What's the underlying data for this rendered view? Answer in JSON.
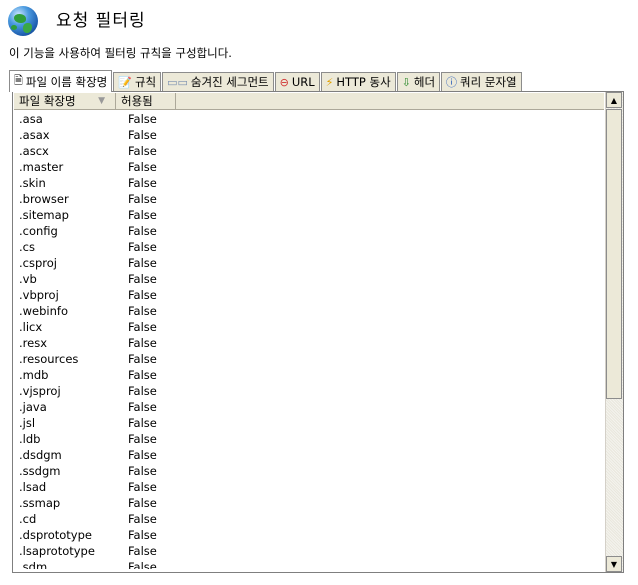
{
  "header": {
    "title": "요청 필터링",
    "description": "이 기능을 사용하여 필터링 규칙을 구성합니다."
  },
  "tabs": [
    {
      "label": "파일 이름 확장명",
      "icon": "file-icon",
      "active": true
    },
    {
      "label": "규칙",
      "icon": "rules-icon",
      "active": false
    },
    {
      "label": "숨겨진 세그먼트",
      "icon": "segments-icon",
      "active": false
    },
    {
      "label": "URL",
      "icon": "url-icon",
      "active": false
    },
    {
      "label": "HTTP 동사",
      "icon": "lightning-icon",
      "active": false
    },
    {
      "label": "헤더",
      "icon": "header-icon",
      "active": false
    },
    {
      "label": "쿼리 문자열",
      "icon": "help-icon",
      "active": false
    }
  ],
  "table": {
    "columns": [
      "파일 확장명",
      "허용됨"
    ],
    "rows": [
      [
        ".asa",
        "False"
      ],
      [
        ".asax",
        "False"
      ],
      [
        ".ascx",
        "False"
      ],
      [
        ".master",
        "False"
      ],
      [
        ".skin",
        "False"
      ],
      [
        ".browser",
        "False"
      ],
      [
        ".sitemap",
        "False"
      ],
      [
        ".config",
        "False"
      ],
      [
        ".cs",
        "False"
      ],
      [
        ".csproj",
        "False"
      ],
      [
        ".vb",
        "False"
      ],
      [
        ".vbproj",
        "False"
      ],
      [
        ".webinfo",
        "False"
      ],
      [
        ".licx",
        "False"
      ],
      [
        ".resx",
        "False"
      ],
      [
        ".resources",
        "False"
      ],
      [
        ".mdb",
        "False"
      ],
      [
        ".vjsproj",
        "False"
      ],
      [
        ".java",
        "False"
      ],
      [
        ".jsl",
        "False"
      ],
      [
        ".ldb",
        "False"
      ],
      [
        ".dsdgm",
        "False"
      ],
      [
        ".ssdgm",
        "False"
      ],
      [
        ".lsad",
        "False"
      ],
      [
        ".ssmap",
        "False"
      ],
      [
        ".cd",
        "False"
      ],
      [
        ".dsprototype",
        "False"
      ],
      [
        ".lsaprototype",
        "False"
      ],
      [
        ".sdm",
        "False"
      ]
    ]
  }
}
